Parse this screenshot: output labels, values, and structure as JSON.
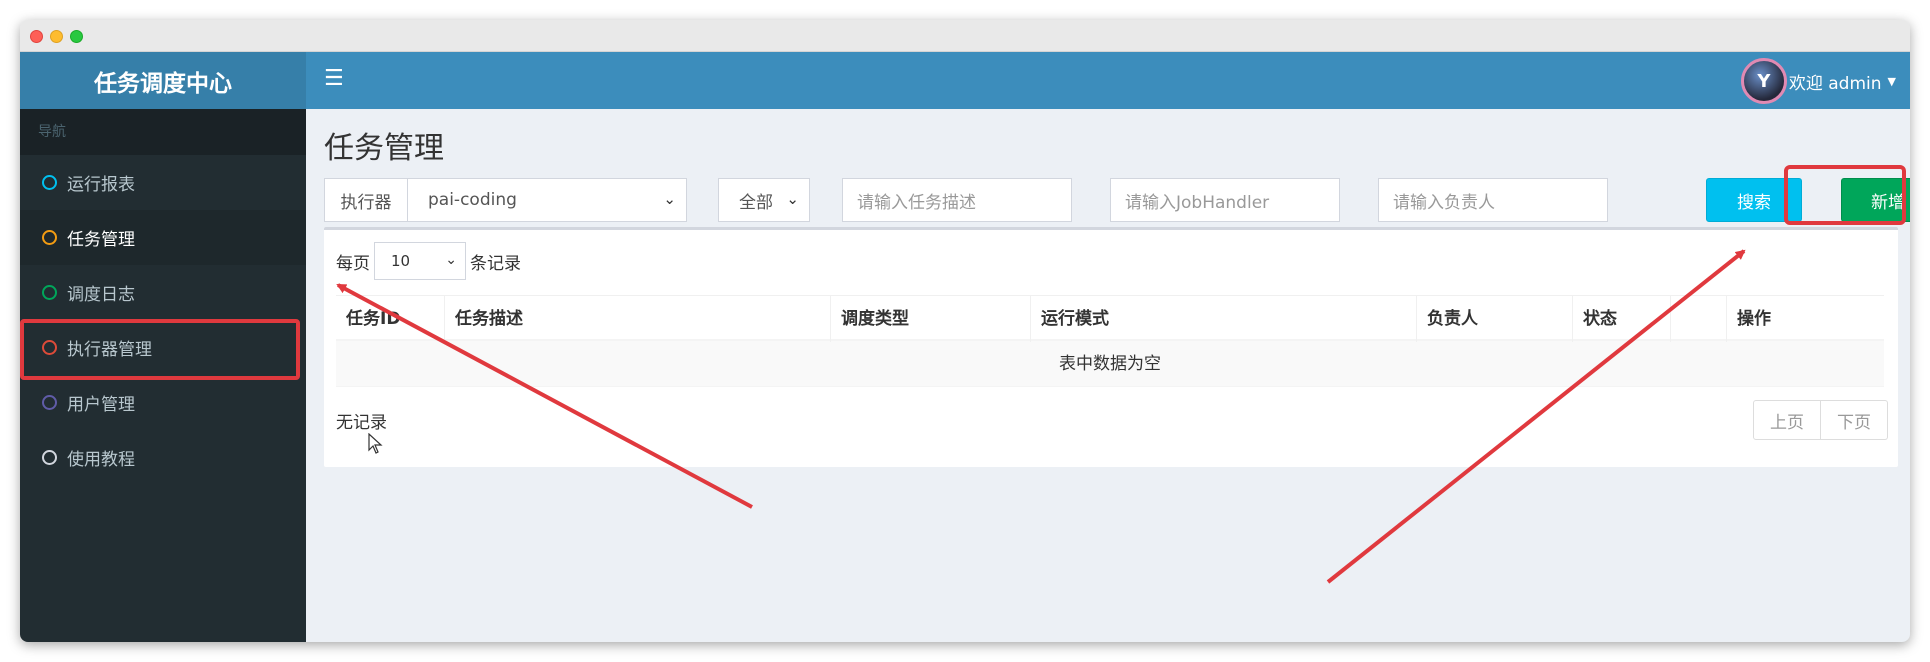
{
  "app": {
    "logo": "任务调度中心"
  },
  "header": {
    "greeting": "欢迎 admin",
    "avatar_glyph": "Y"
  },
  "sidebar": {
    "header": "导航",
    "items": [
      {
        "label": "运行报表",
        "color": "#00c0ef"
      },
      {
        "label": "任务管理",
        "color": "#f39c12"
      },
      {
        "label": "调度日志",
        "color": "#00a65a"
      },
      {
        "label": "执行器管理",
        "color": "#dd4b39"
      },
      {
        "label": "用户管理",
        "color": "#605ca8"
      },
      {
        "label": "使用教程",
        "color": "#d2d6de"
      }
    ]
  },
  "page": {
    "title": "任务管理"
  },
  "filters": {
    "executor_label": "执行器",
    "executor_value": "pai-coding",
    "status_value": "全部",
    "desc_placeholder": "请输入任务描述",
    "handler_placeholder": "请输入JobHandler",
    "author_placeholder": "请输入负责人",
    "search_label": "搜索",
    "add_label": "新增"
  },
  "table": {
    "length_prefix": "每页",
    "length_value": "10",
    "length_suffix": "条记录",
    "columns": [
      "任务ID",
      "任务描述",
      "调度类型",
      "运行模式",
      "负责人",
      "状态",
      "操作"
    ],
    "empty_text": "表中数据为空",
    "info_text": "无记录",
    "prev_label": "上页",
    "next_label": "下页"
  },
  "colors": {
    "annotation": "#e0393e",
    "header_bg": "#3c8dbc",
    "sidebar_bg": "#222d32"
  }
}
